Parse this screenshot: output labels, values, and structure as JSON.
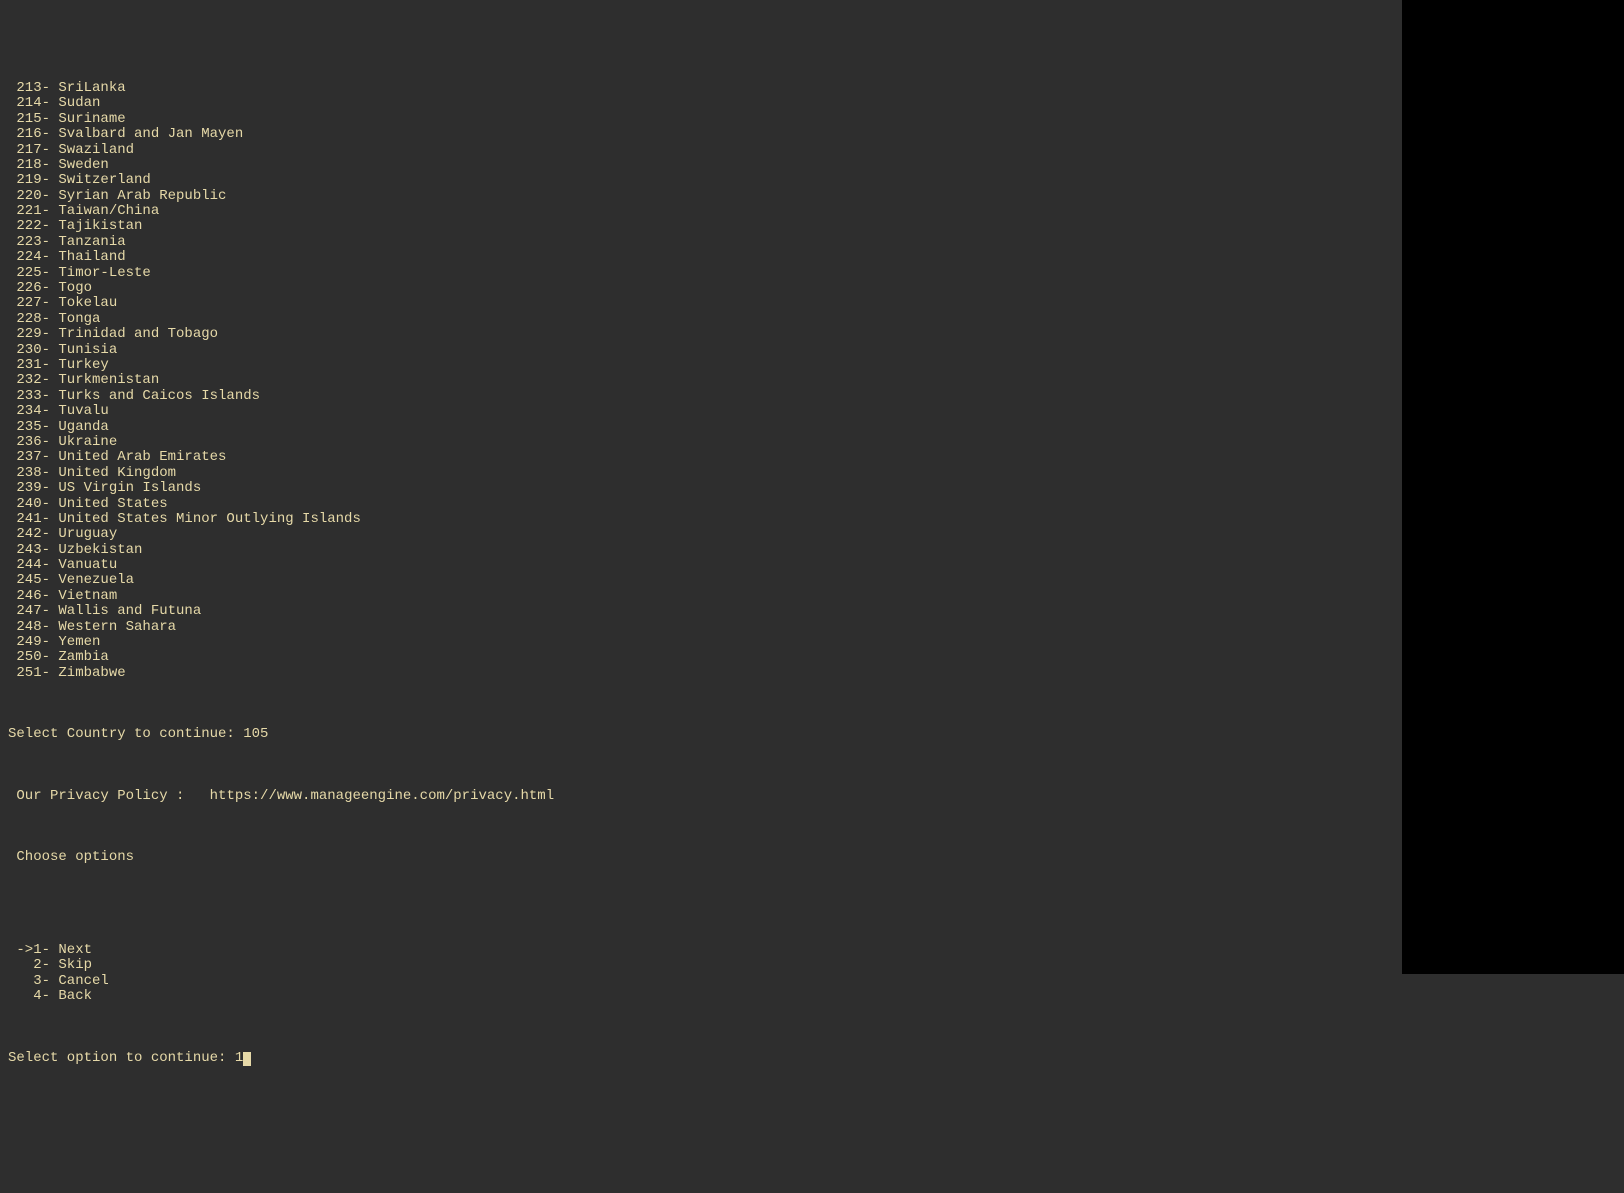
{
  "countries": [
    {
      "num": "213",
      "name": "SriLanka"
    },
    {
      "num": "214",
      "name": "Sudan"
    },
    {
      "num": "215",
      "name": "Suriname"
    },
    {
      "num": "216",
      "name": "Svalbard and Jan Mayen"
    },
    {
      "num": "217",
      "name": "Swaziland"
    },
    {
      "num": "218",
      "name": "Sweden"
    },
    {
      "num": "219",
      "name": "Switzerland"
    },
    {
      "num": "220",
      "name": "Syrian Arab Republic"
    },
    {
      "num": "221",
      "name": "Taiwan/China"
    },
    {
      "num": "222",
      "name": "Tajikistan"
    },
    {
      "num": "223",
      "name": "Tanzania"
    },
    {
      "num": "224",
      "name": "Thailand"
    },
    {
      "num": "225",
      "name": "Timor-Leste"
    },
    {
      "num": "226",
      "name": "Togo"
    },
    {
      "num": "227",
      "name": "Tokelau"
    },
    {
      "num": "228",
      "name": "Tonga"
    },
    {
      "num": "229",
      "name": "Trinidad and Tobago"
    },
    {
      "num": "230",
      "name": "Tunisia"
    },
    {
      "num": "231",
      "name": "Turkey"
    },
    {
      "num": "232",
      "name": "Turkmenistan"
    },
    {
      "num": "233",
      "name": "Turks and Caicos Islands"
    },
    {
      "num": "234",
      "name": "Tuvalu"
    },
    {
      "num": "235",
      "name": "Uganda"
    },
    {
      "num": "236",
      "name": "Ukraine"
    },
    {
      "num": "237",
      "name": "United Arab Emirates"
    },
    {
      "num": "238",
      "name": "United Kingdom"
    },
    {
      "num": "239",
      "name": "US Virgin Islands"
    },
    {
      "num": "240",
      "name": "United States"
    },
    {
      "num": "241",
      "name": "United States Minor Outlying Islands"
    },
    {
      "num": "242",
      "name": "Uruguay"
    },
    {
      "num": "243",
      "name": "Uzbekistan"
    },
    {
      "num": "244",
      "name": "Vanuatu"
    },
    {
      "num": "245",
      "name": "Venezuela"
    },
    {
      "num": "246",
      "name": "Vietnam"
    },
    {
      "num": "247",
      "name": "Wallis and Futuna"
    },
    {
      "num": "248",
      "name": "Western Sahara"
    },
    {
      "num": "249",
      "name": "Yemen"
    },
    {
      "num": "250",
      "name": "Zambia"
    },
    {
      "num": "251",
      "name": "Zimbabwe"
    }
  ],
  "select_country_prompt": "Select Country to continue: ",
  "select_country_value": "105",
  "privacy_label": " Our Privacy Policy :   ",
  "privacy_url": "https://www.manageengine.com/privacy.html",
  "choose_options_label": " Choose options",
  "options": [
    {
      "marker": " ->",
      "num": "1",
      "label": "Next"
    },
    {
      "marker": "   ",
      "num": "2",
      "label": "Skip"
    },
    {
      "marker": "   ",
      "num": "3",
      "label": "Cancel"
    },
    {
      "marker": "   ",
      "num": "4",
      "label": "Back"
    }
  ],
  "select_option_prompt": "Select option to continue: ",
  "select_option_value": "1"
}
